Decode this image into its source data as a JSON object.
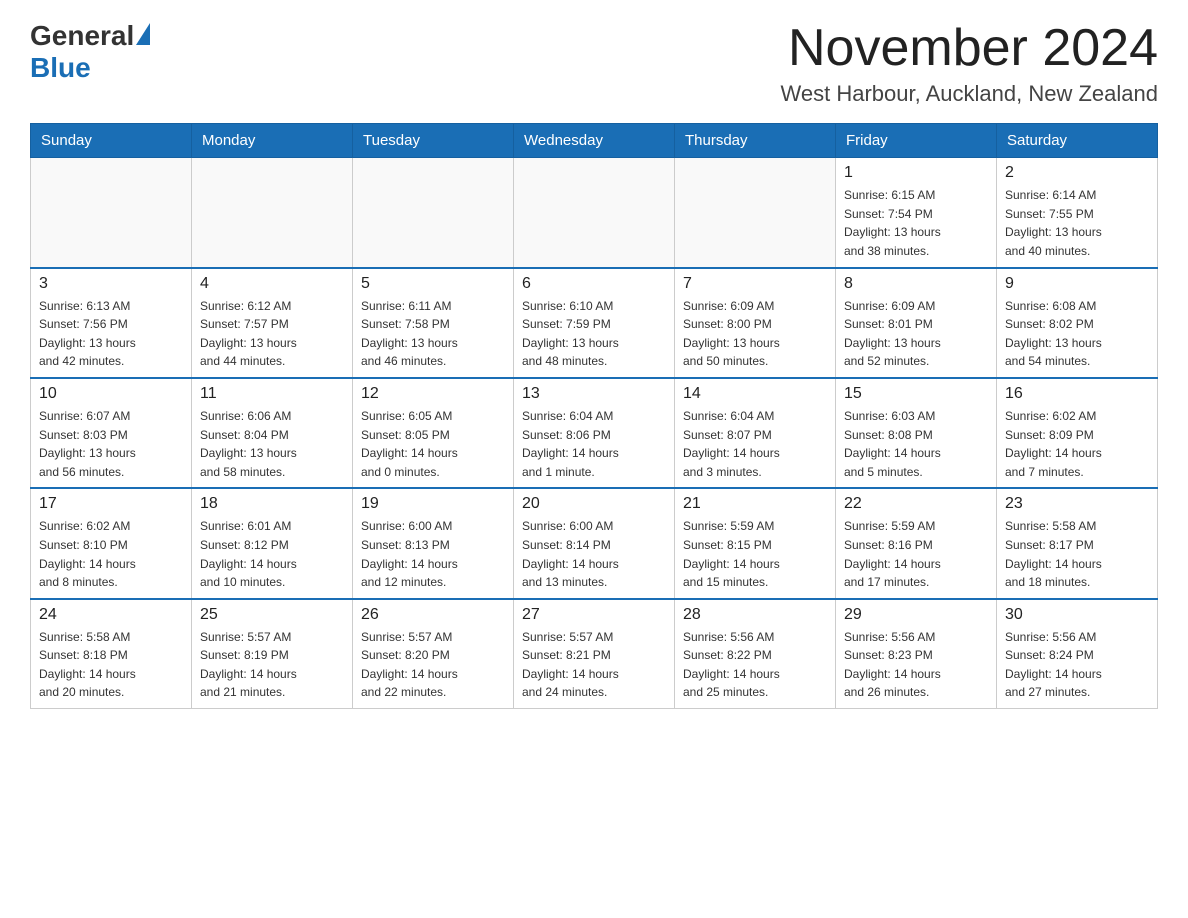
{
  "header": {
    "title": "November 2024",
    "subtitle": "West Harbour, Auckland, New Zealand",
    "logo_general": "General",
    "logo_blue": "Blue"
  },
  "days_of_week": [
    "Sunday",
    "Monday",
    "Tuesday",
    "Wednesday",
    "Thursday",
    "Friday",
    "Saturday"
  ],
  "weeks": [
    [
      {
        "day": "",
        "info": ""
      },
      {
        "day": "",
        "info": ""
      },
      {
        "day": "",
        "info": ""
      },
      {
        "day": "",
        "info": ""
      },
      {
        "day": "",
        "info": ""
      },
      {
        "day": "1",
        "info": "Sunrise: 6:15 AM\nSunset: 7:54 PM\nDaylight: 13 hours\nand 38 minutes."
      },
      {
        "day": "2",
        "info": "Sunrise: 6:14 AM\nSunset: 7:55 PM\nDaylight: 13 hours\nand 40 minutes."
      }
    ],
    [
      {
        "day": "3",
        "info": "Sunrise: 6:13 AM\nSunset: 7:56 PM\nDaylight: 13 hours\nand 42 minutes."
      },
      {
        "day": "4",
        "info": "Sunrise: 6:12 AM\nSunset: 7:57 PM\nDaylight: 13 hours\nand 44 minutes."
      },
      {
        "day": "5",
        "info": "Sunrise: 6:11 AM\nSunset: 7:58 PM\nDaylight: 13 hours\nand 46 minutes."
      },
      {
        "day": "6",
        "info": "Sunrise: 6:10 AM\nSunset: 7:59 PM\nDaylight: 13 hours\nand 48 minutes."
      },
      {
        "day": "7",
        "info": "Sunrise: 6:09 AM\nSunset: 8:00 PM\nDaylight: 13 hours\nand 50 minutes."
      },
      {
        "day": "8",
        "info": "Sunrise: 6:09 AM\nSunset: 8:01 PM\nDaylight: 13 hours\nand 52 minutes."
      },
      {
        "day": "9",
        "info": "Sunrise: 6:08 AM\nSunset: 8:02 PM\nDaylight: 13 hours\nand 54 minutes."
      }
    ],
    [
      {
        "day": "10",
        "info": "Sunrise: 6:07 AM\nSunset: 8:03 PM\nDaylight: 13 hours\nand 56 minutes."
      },
      {
        "day": "11",
        "info": "Sunrise: 6:06 AM\nSunset: 8:04 PM\nDaylight: 13 hours\nand 58 minutes."
      },
      {
        "day": "12",
        "info": "Sunrise: 6:05 AM\nSunset: 8:05 PM\nDaylight: 14 hours\nand 0 minutes."
      },
      {
        "day": "13",
        "info": "Sunrise: 6:04 AM\nSunset: 8:06 PM\nDaylight: 14 hours\nand 1 minute."
      },
      {
        "day": "14",
        "info": "Sunrise: 6:04 AM\nSunset: 8:07 PM\nDaylight: 14 hours\nand 3 minutes."
      },
      {
        "day": "15",
        "info": "Sunrise: 6:03 AM\nSunset: 8:08 PM\nDaylight: 14 hours\nand 5 minutes."
      },
      {
        "day": "16",
        "info": "Sunrise: 6:02 AM\nSunset: 8:09 PM\nDaylight: 14 hours\nand 7 minutes."
      }
    ],
    [
      {
        "day": "17",
        "info": "Sunrise: 6:02 AM\nSunset: 8:10 PM\nDaylight: 14 hours\nand 8 minutes."
      },
      {
        "day": "18",
        "info": "Sunrise: 6:01 AM\nSunset: 8:12 PM\nDaylight: 14 hours\nand 10 minutes."
      },
      {
        "day": "19",
        "info": "Sunrise: 6:00 AM\nSunset: 8:13 PM\nDaylight: 14 hours\nand 12 minutes."
      },
      {
        "day": "20",
        "info": "Sunrise: 6:00 AM\nSunset: 8:14 PM\nDaylight: 14 hours\nand 13 minutes."
      },
      {
        "day": "21",
        "info": "Sunrise: 5:59 AM\nSunset: 8:15 PM\nDaylight: 14 hours\nand 15 minutes."
      },
      {
        "day": "22",
        "info": "Sunrise: 5:59 AM\nSunset: 8:16 PM\nDaylight: 14 hours\nand 17 minutes."
      },
      {
        "day": "23",
        "info": "Sunrise: 5:58 AM\nSunset: 8:17 PM\nDaylight: 14 hours\nand 18 minutes."
      }
    ],
    [
      {
        "day": "24",
        "info": "Sunrise: 5:58 AM\nSunset: 8:18 PM\nDaylight: 14 hours\nand 20 minutes."
      },
      {
        "day": "25",
        "info": "Sunrise: 5:57 AM\nSunset: 8:19 PM\nDaylight: 14 hours\nand 21 minutes."
      },
      {
        "day": "26",
        "info": "Sunrise: 5:57 AM\nSunset: 8:20 PM\nDaylight: 14 hours\nand 22 minutes."
      },
      {
        "day": "27",
        "info": "Sunrise: 5:57 AM\nSunset: 8:21 PM\nDaylight: 14 hours\nand 24 minutes."
      },
      {
        "day": "28",
        "info": "Sunrise: 5:56 AM\nSunset: 8:22 PM\nDaylight: 14 hours\nand 25 minutes."
      },
      {
        "day": "29",
        "info": "Sunrise: 5:56 AM\nSunset: 8:23 PM\nDaylight: 14 hours\nand 26 minutes."
      },
      {
        "day": "30",
        "info": "Sunrise: 5:56 AM\nSunset: 8:24 PM\nDaylight: 14 hours\nand 27 minutes."
      }
    ]
  ]
}
